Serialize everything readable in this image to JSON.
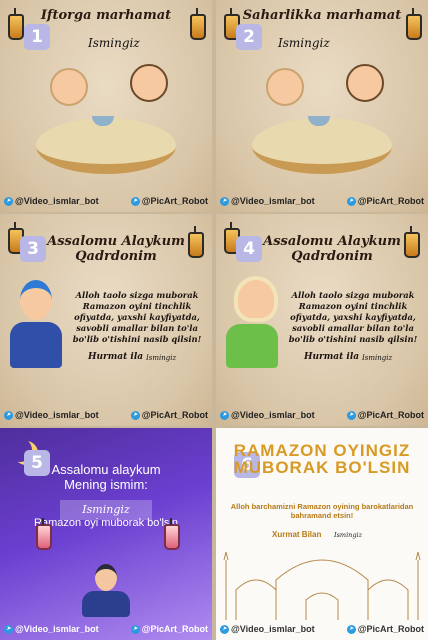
{
  "cards": [
    {
      "number": "1",
      "title": "Iftorga marhamat",
      "name": "Ismingiz"
    },
    {
      "number": "2",
      "title": "Saharlikka marhamat",
      "name": "Ismingiz"
    },
    {
      "number": "3",
      "title": "Assalomu Alaykum Qadrdonim",
      "message": "Alloh taolo sizga muborak Ramazon oyini tinchlik ofiyatda, yaxshi kayfiyatda, savobli amallar bilan to'la bo'lib o'tishini nasib qilsin!",
      "regards": "Hurmat ila",
      "name": "Ismingiz"
    },
    {
      "number": "4",
      "title": "Assalomu Alaykum Qadrdonim",
      "message": "Alloh taolo sizga muborak Ramazon oyini tinchlik ofiyatda, yaxshi kayfiyatda, savobli amallar bilan to'la bo'lib o'tishini nasib qilsin!",
      "regards": "Hurmat ila",
      "name": "Ismingiz"
    },
    {
      "number": "5",
      "line1": "Assalomu alaykum",
      "line2": "Mening ismim:",
      "name": "Ismingiz",
      "line3": "Ramazon oyi muborak bo'lsin"
    },
    {
      "number": "6",
      "title": "RAMAZON OYINGIZ MUBORAK BO'LSIN",
      "message": "Alloh barchamizni Ramazon oyining barokatlaridan bahramand etsin!",
      "regards": "Xurmat Bilan",
      "name": "Ismingiz"
    }
  ],
  "footer": {
    "left": "@Video_ismlar_bot",
    "right": "@PicArt_Robot"
  }
}
